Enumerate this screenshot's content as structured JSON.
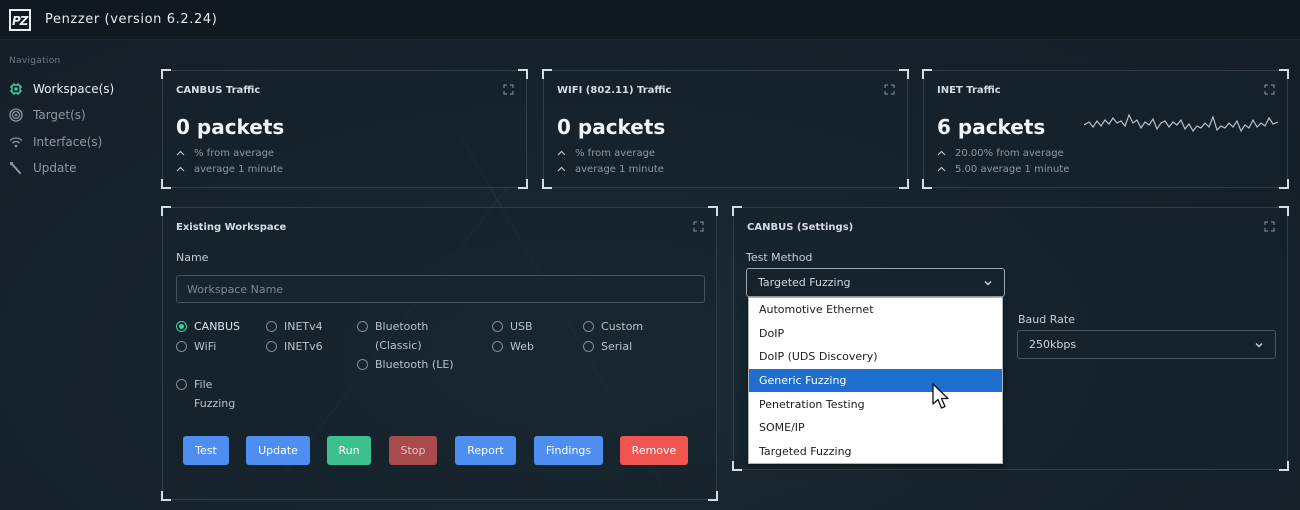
{
  "app": {
    "title": "Penzzer (version 6.2.24)",
    "logo_text": "PZ"
  },
  "nav": {
    "heading": "Navigation",
    "items": [
      {
        "label": "Workspace(s)",
        "icon": "chip-icon",
        "active": true
      },
      {
        "label": "Target(s)",
        "icon": "target-icon",
        "active": false
      },
      {
        "label": "Interface(s)",
        "icon": "wifi-icon",
        "active": false
      },
      {
        "label": "Update",
        "icon": "update-icon",
        "active": false
      }
    ]
  },
  "traffic": [
    {
      "title": "CANBUS Traffic",
      "value": "0 packets",
      "stat1": "% from average",
      "stat2": "average 1 minute"
    },
    {
      "title": "WIFI (802.11) Traffic",
      "value": "0 packets",
      "stat1": "% from average",
      "stat2": "average 1 minute"
    },
    {
      "title": "INET Traffic",
      "value": "6 packets",
      "stat1": "20.00% from average",
      "stat2": "5.00 average 1 minute"
    }
  ],
  "workspace": {
    "title": "Existing Workspace",
    "name_label": "Name",
    "name_placeholder": "Workspace Name",
    "interfaces": {
      "canbus": "CANBUS",
      "wifi": "WiFi",
      "file_fuzzing": "File Fuzzing",
      "inetv4": "INETv4",
      "inetv6": "INETv6",
      "bluetooth_classic": "Bluetooth (Classic)",
      "bluetooth_le": "Bluetooth (LE)",
      "usb": "USB",
      "web": "Web",
      "custom": "Custom",
      "serial": "Serial"
    },
    "selected_interface": "CANBUS",
    "buttons": {
      "test": "Test",
      "update": "Update",
      "run": "Run",
      "stop": "Stop",
      "report": "Report",
      "findings": "Findings",
      "remove": "Remove"
    }
  },
  "settings": {
    "title": "CANBUS (Settings)",
    "test_method_label": "Test Method",
    "test_method_value": "Targeted Fuzzing",
    "baud_rate_label": "Baud Rate",
    "baud_rate_value": "250kbps",
    "dropdown_options": [
      "Automotive Ethernet",
      "DoIP",
      "DoIP (UDS Discovery)",
      "Generic Fuzzing",
      "Penetration Testing",
      "SOME/IP",
      "Targeted Fuzzing"
    ],
    "highlighted_option": "Generic Fuzzing"
  },
  "colors": {
    "accent_green": "#3fd2a0",
    "button_blue": "#4d8ef0",
    "button_green": "#3cc08e",
    "button_stop": "#a94a4d",
    "button_remove": "#ef5450",
    "dropdown_highlight": "#1f6fd1"
  }
}
